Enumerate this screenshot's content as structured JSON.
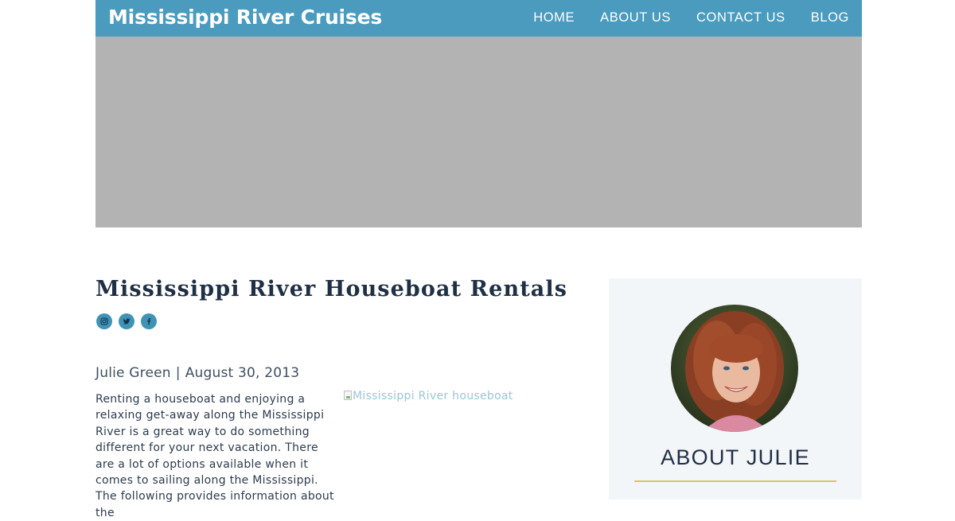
{
  "site": {
    "title": "Mississippi River Cruises"
  },
  "nav": {
    "items": [
      "HOME",
      "ABOUT US",
      "CONTACT US",
      "BLOG"
    ]
  },
  "post": {
    "title": "Mississippi River Houseboat Rentals",
    "author": "Julie Green",
    "separator": "|",
    "date": "August 30, 2013",
    "body": "Renting a houseboat and enjoying a relaxing get-away along the Mississippi River is a great way to do something different for your next vacation. There are a lot of options available when it comes to sailing along the Mississippi. The following provides information about the",
    "image_alt": "Mississippi River houseboat"
  },
  "social": {
    "icons": [
      "instagram-icon",
      "twitter-icon",
      "facebook-icon"
    ]
  },
  "sidebar": {
    "heading": "ABOUT JULIE"
  },
  "colors": {
    "header": "#4a9bbd",
    "hero": "#b3b3b3",
    "accent_rule": "#e2c25b",
    "text_dark": "#1f2f44",
    "social": "#3f93b6",
    "sidebar_bg": "#f3f6f9"
  }
}
